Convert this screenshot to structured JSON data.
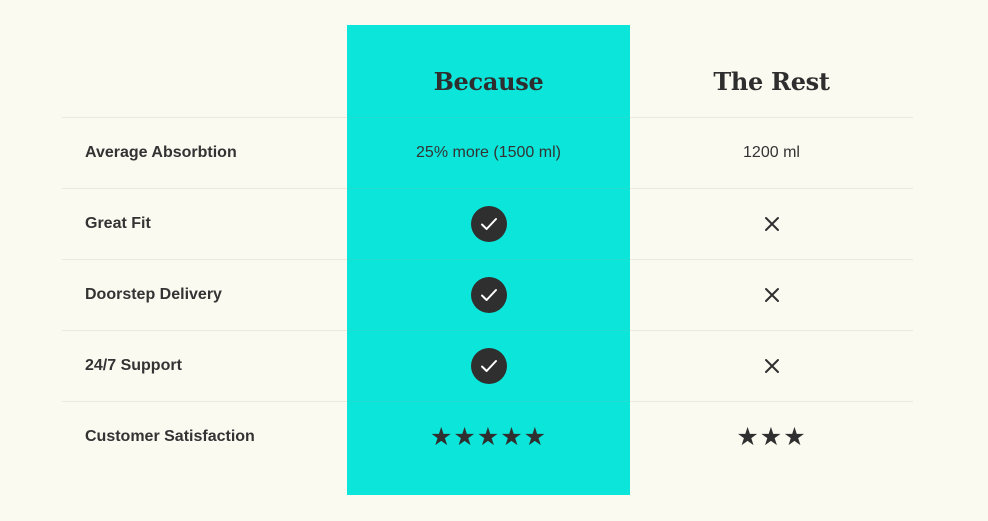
{
  "columns": {
    "because": "Because",
    "rest": "The Rest"
  },
  "colors": {
    "background": "#fbfaf1",
    "highlight": "#0ce5d9",
    "text": "#2e2e2e",
    "divider": "#ebe8dc"
  },
  "rows": [
    {
      "label": "Average Absorbtion",
      "because": {
        "type": "text",
        "value": "25% more (1500 ml)"
      },
      "rest": {
        "type": "text",
        "value": "1200 ml"
      }
    },
    {
      "label": "Great Fit",
      "because": {
        "type": "icon",
        "icon": "check-circle-icon"
      },
      "rest": {
        "type": "icon",
        "icon": "x-icon"
      }
    },
    {
      "label": "Doorstep Delivery",
      "because": {
        "type": "icon",
        "icon": "check-circle-icon"
      },
      "rest": {
        "type": "icon",
        "icon": "x-icon"
      }
    },
    {
      "label": "24/7 Support",
      "because": {
        "type": "icon",
        "icon": "check-circle-icon"
      },
      "rest": {
        "type": "icon",
        "icon": "x-icon"
      }
    },
    {
      "label": "Customer Satisfaction",
      "because": {
        "type": "rating",
        "value": 5,
        "glyphs": "★★★★★"
      },
      "rest": {
        "type": "rating",
        "value": 3,
        "glyphs": "★★★"
      }
    }
  ]
}
